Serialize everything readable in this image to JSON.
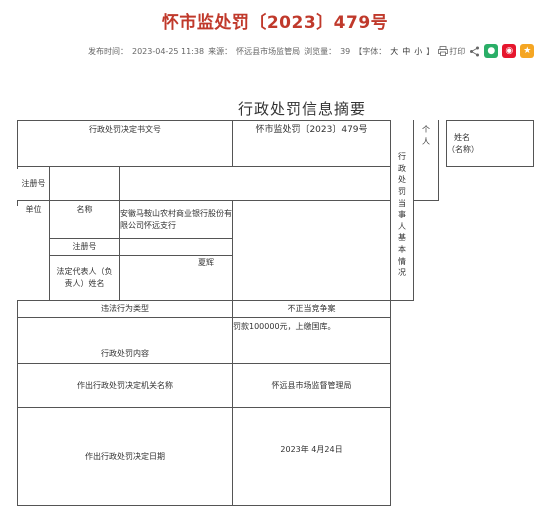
{
  "header": {
    "title": "怀市监处罚〔2023〕479号",
    "meta": {
      "publish_label": "发布时间：",
      "publish_time": "2023-04-25 11:38",
      "source_label": "来源：",
      "source": "怀远县市场监管局",
      "views_label": "浏览量：",
      "views": "39",
      "font_label": "【字体：",
      "font_large": "大",
      "font_medium": "中",
      "font_small": "小",
      "font_close": "】",
      "print_label": "打印"
    }
  },
  "document": {
    "table_title": "行政处罚信息摘要",
    "doc_number_label": "行政处罚决定书文号",
    "doc_number": "怀市监处罚〔2023〕479号",
    "party_section_label": "行政处罚当事人基本情况",
    "individual_label": "个人",
    "name_label_individual": "姓名（名称）",
    "reg_no_label": "注册号",
    "unit_label": "单位",
    "name_label": "名称",
    "unit_name": "安徽马鞍山农村商业银行股份有限公司怀远支行",
    "unit_reg_no_label": "注册号",
    "legal_rep_label": "法定代表人（负责人）姓名",
    "legal_rep_name": "夏辉",
    "violation_type_label": "违法行为类型",
    "violation_type": "不正当竞争案",
    "penalty_content_label": "行政处罚内容",
    "penalty_content": "罚款100000元，上缴国库。",
    "authority_label": "作出行政处罚决定机关名称",
    "authority": "怀远县市场监督管理局",
    "decision_date_label": "作出行政处罚决定日期",
    "decision_date": "2023年 4月24日"
  }
}
